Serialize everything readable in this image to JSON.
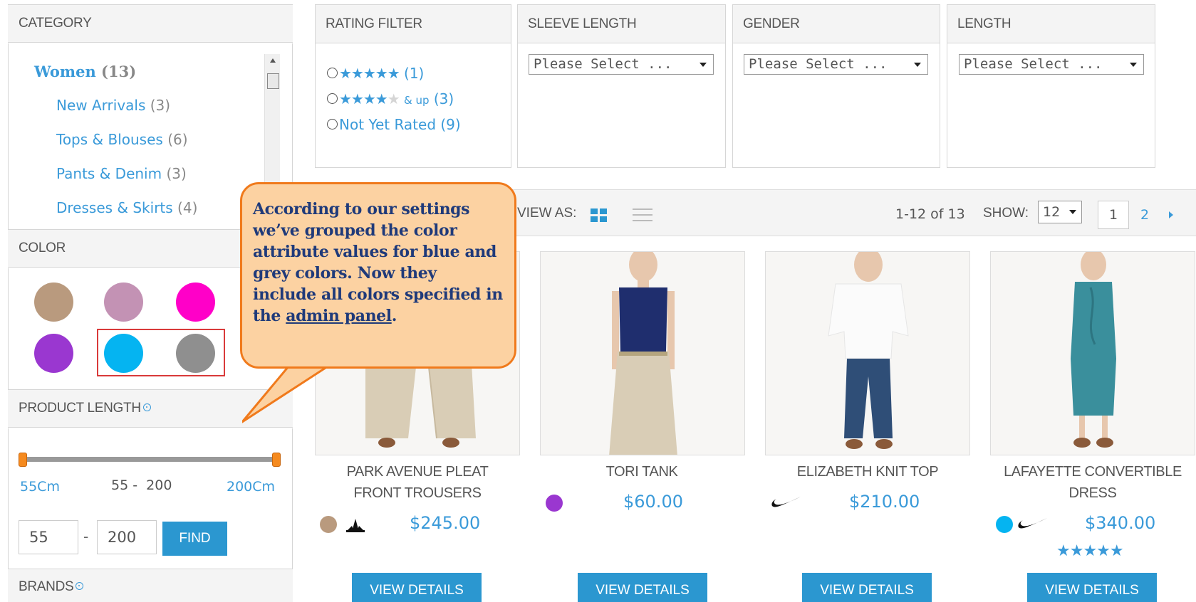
{
  "sidebar": {
    "category": {
      "title": "CATEGORY",
      "items": [
        {
          "label": "Women",
          "count": "(13)"
        },
        {
          "label": "New Arrivals",
          "count": "(3)"
        },
        {
          "label": "Tops & Blouses",
          "count": "(6)"
        },
        {
          "label": "Pants & Denim",
          "count": "(3)"
        },
        {
          "label": "Dresses & Skirts",
          "count": "(4)"
        }
      ]
    },
    "color": {
      "title": "COLOR",
      "swatches": [
        "#b99a7e",
        "#c392b4",
        "#ff00c8",
        "#9a37d0",
        "#05b4f1",
        "#8f8f8f"
      ],
      "highlight_color": "#d93a3a"
    },
    "product_length": {
      "title": "PRODUCT LENGTH",
      "min_label": "55Cm",
      "range_label": "55 -  200",
      "max_label": "200Cm",
      "min_value": "55",
      "separator": "-",
      "max_value": "200",
      "find_label": "FIND"
    },
    "brands": {
      "title": "BRANDS"
    }
  },
  "filters": {
    "rating": {
      "title": "RATING FILTER",
      "options": [
        {
          "stars_on": "★★★★★",
          "stars_off": "",
          "suffix": "",
          "count": "(1)"
        },
        {
          "stars_on": "★★★★",
          "stars_off": "★",
          "suffix": "& up",
          "count": "(3)"
        },
        {
          "label": "Not Yet Rated",
          "count": "(9)"
        }
      ]
    },
    "sleeve_length": {
      "title": "SLEEVE LENGTH",
      "selected": "Please Select ..."
    },
    "gender": {
      "title": "GENDER",
      "selected": "Please Select ..."
    },
    "length": {
      "title": "LENGTH",
      "selected": "Please Select ..."
    }
  },
  "toolbar": {
    "view_as": "VIEW AS:",
    "results": "1-12 of 13",
    "show_label": "SHOW:",
    "show_value": "12",
    "current_page": "1",
    "next_page": "2"
  },
  "products": [
    {
      "name_line1": "PARK AVENUE PLEAT",
      "name_line2": "FRONT TROUSERS",
      "price": "$245.00",
      "color": "#b99a7e",
      "brand": "adidas",
      "button": "VIEW DETAILS"
    },
    {
      "name_line1": "TORI TANK",
      "name_line2": "",
      "price": "$60.00",
      "color": "#9a37d0",
      "brand": "",
      "button": "VIEW DETAILS"
    },
    {
      "name_line1": "ELIZABETH KNIT TOP",
      "name_line2": "",
      "price": "$210.00",
      "color": "",
      "brand": "nike",
      "button": "VIEW DETAILS"
    },
    {
      "name_line1": "LAFAYETTE CONVERTIBLE",
      "name_line2": "DRESS",
      "price": "$340.00",
      "color": "#05b4f1",
      "brand": "nike",
      "rating": "★★★★★",
      "button": "VIEW DETAILS"
    }
  ],
  "callout": {
    "text_before": "According to our settings we’ve grouped  the color attribute values for blue and grey colors. Now they include all colors specified in the ",
    "link": "admin panel",
    "text_after": "."
  },
  "colors": {
    "accent": "#2b97d0",
    "link": "#3a9ad9",
    "callout_bg": "#fcd2a2",
    "callout_border": "#f07a1c"
  }
}
